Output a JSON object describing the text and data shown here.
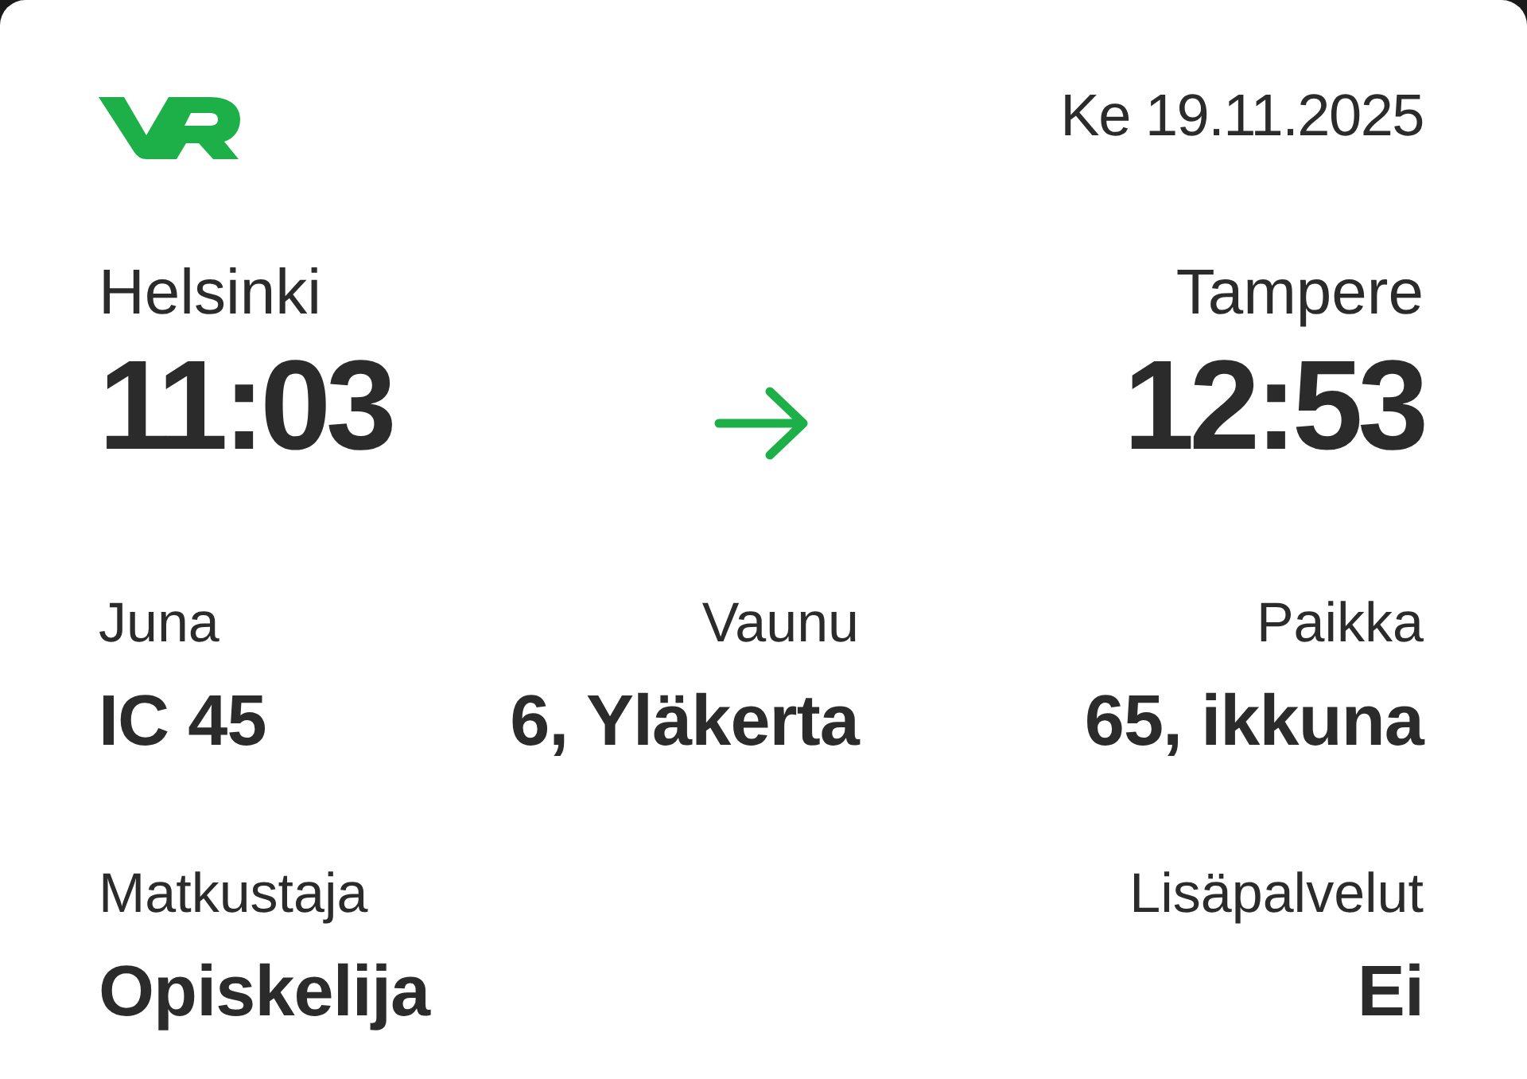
{
  "header": {
    "date": "Ke 19.11.2025"
  },
  "journey": {
    "departure": {
      "station": "Helsinki",
      "time": "11:03"
    },
    "arrival": {
      "station": "Tampere",
      "time": "12:53"
    }
  },
  "details": [
    {
      "label": "Juna",
      "value": "IC 45"
    },
    {
      "label": "Vaunu",
      "value": "6, Yläkerta"
    },
    {
      "label": "Paikka",
      "value": "65, ikkuna"
    }
  ],
  "extras": [
    {
      "label": "Matkustaja",
      "value": "Opiskelija"
    },
    {
      "label": "Lisäpalvelut",
      "value": "Ei"
    }
  ]
}
